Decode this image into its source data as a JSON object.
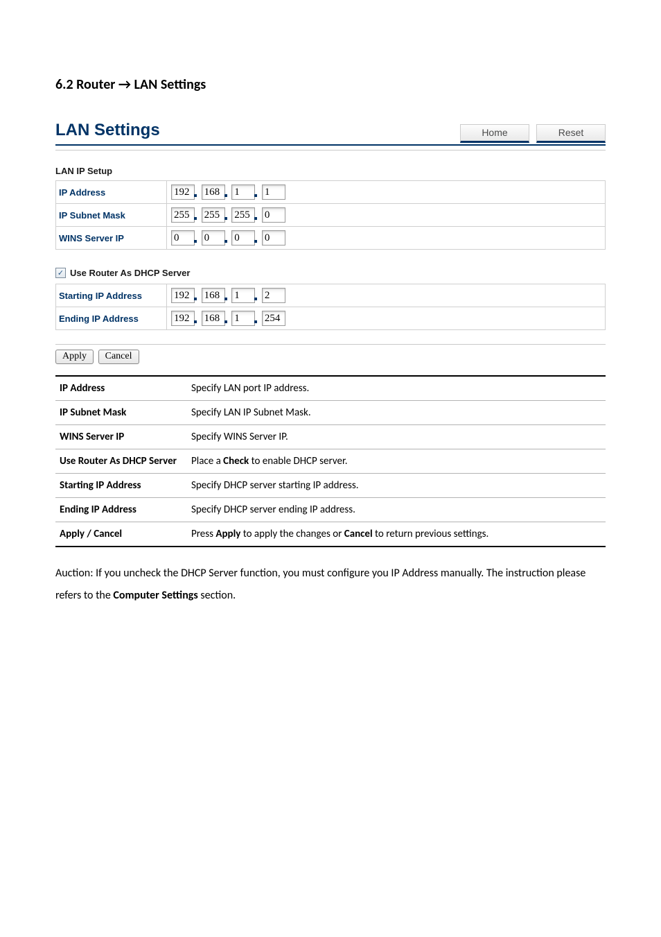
{
  "heading": "6.2 Router → LAN Settings",
  "panel": {
    "title": "LAN Settings",
    "home_btn": "Home",
    "reset_btn": "Reset"
  },
  "lan_ip_setup": {
    "title": "LAN IP Setup",
    "rows": {
      "ip_address": {
        "label": "IP Address",
        "o": [
          "192",
          "168",
          "1",
          "1"
        ]
      },
      "subnet": {
        "label": "IP Subnet Mask",
        "o": [
          "255",
          "255",
          "255",
          "0"
        ]
      },
      "wins": {
        "label": "WINS Server IP",
        "o": [
          "0",
          "0",
          "0",
          "0"
        ]
      }
    }
  },
  "dhcp": {
    "checkbox_label": "Use Router As DHCP Server",
    "checked": true,
    "rows": {
      "start": {
        "label": "Starting IP Address",
        "o": [
          "192",
          "168",
          "1",
          "2"
        ]
      },
      "end": {
        "label": "Ending IP Address",
        "o": [
          "192",
          "168",
          "1",
          "254"
        ]
      }
    }
  },
  "buttons": {
    "apply": "Apply",
    "cancel": "Cancel"
  },
  "descriptions": [
    {
      "label": "IP Address",
      "text": "Specify LAN port IP address."
    },
    {
      "label": "IP Subnet Mask",
      "text": "Specify LAN IP Subnet Mask."
    },
    {
      "label": "WINS Server IP",
      "text": "Specify WINS Server IP."
    },
    {
      "label": "Use Router As DHCP Server",
      "text_pre": "Place a ",
      "text_bold": "Check",
      "text_post": " to enable DHCP server."
    },
    {
      "label": "Starting IP Address",
      "text": "Specify DHCP server starting IP address."
    },
    {
      "label": "Ending IP Address",
      "text": "Specify DHCP server ending IP address."
    },
    {
      "label": "Apply / Cancel",
      "text_pre": "Press ",
      "text_bold": "Apply",
      "text_mid": " to apply the changes or ",
      "text_bold2": "Cancel",
      "text_post": " to return previous settings."
    }
  ],
  "caution": {
    "pre": "Auction: If you uncheck the DHCP Server function, you must configure you IP Address manually. The instruction please refers to the ",
    "bold": "Computer Settings",
    "post": " section."
  }
}
